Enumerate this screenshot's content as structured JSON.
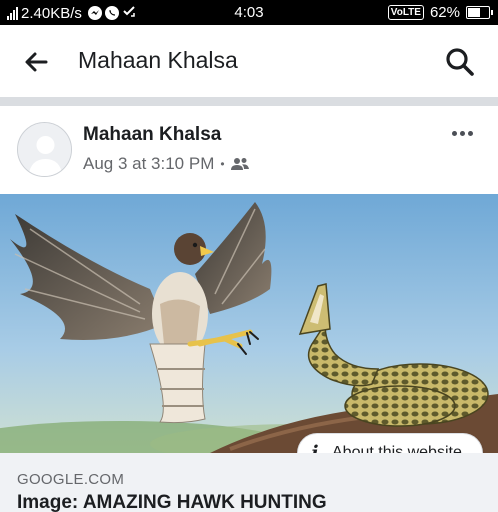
{
  "status_bar": {
    "network_speed": "2.40KB/s",
    "time": "4:03",
    "volte": "VoLTE",
    "battery": "62%",
    "battery_level": 0.62,
    "icons": [
      "signal-icon",
      "messenger-icon",
      "whatsapp-icon",
      "sync-icon",
      "battery-icon"
    ]
  },
  "header": {
    "title": "Mahaan Khalsa",
    "back_icon": "back-arrow-icon",
    "search_icon": "search-icon"
  },
  "post": {
    "author": "Mahaan Khalsa",
    "timestamp": "Aug 3 at 3:10 PM",
    "separator": "•",
    "audience_icon": "friends-icon",
    "more_icon": "more-options-icon",
    "image": {
      "about_label": "About this website",
      "about_icon": "info-icon"
    },
    "link": {
      "domain": "GOOGLE.COM",
      "title": "Image: AMAZING HAWK HUNTING"
    }
  },
  "colors": {
    "status_bar_bg": "#000000",
    "divider": "#dadde1",
    "text_primary": "#1c1e21",
    "text_secondary": "#65676b",
    "link_bg": "#f0f2f5"
  }
}
